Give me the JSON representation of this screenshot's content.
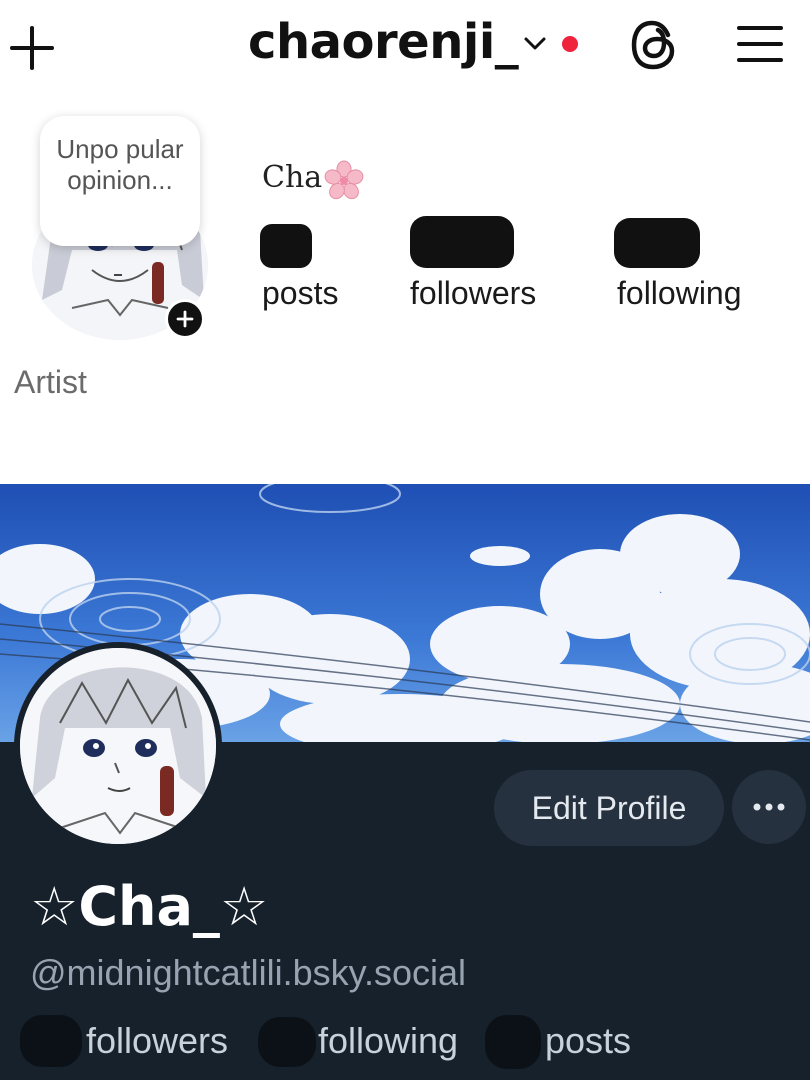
{
  "instagram": {
    "username": "chaorenji_",
    "note_text": "Unpo pular opinion...",
    "profile_name": "Cha",
    "stats": {
      "posts_label": "posts",
      "followers_label": "followers",
      "following_label": "following"
    },
    "bio": "Artist",
    "notification_dot_color": "#ef233c"
  },
  "bluesky": {
    "edit_profile_label": "Edit Profile",
    "more_label": "•••",
    "display_name": "☆Cha_☆",
    "handle": "@midnightcatlili.bsky.social",
    "stats": {
      "followers_label": "followers",
      "following_label": "following",
      "posts_label": "posts"
    },
    "background_color": "#17212c",
    "button_color": "#25313e"
  }
}
